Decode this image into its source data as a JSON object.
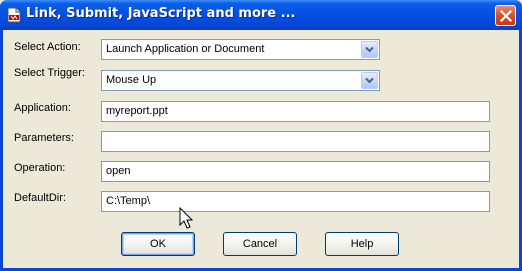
{
  "window": {
    "title": "Link, Submit, JavaScript and more ..."
  },
  "icons": {
    "title_icon": "pdf-document-icon",
    "close_icon": "close-x-icon",
    "dropdown_icon": "chevron-down-icon",
    "cursor_icon": "mouse-pointer-icon"
  },
  "form": {
    "select_action": {
      "label": "Select Action:",
      "value": "Launch Application or Document"
    },
    "select_trigger": {
      "label": "Select Trigger:",
      "value": "Mouse Up"
    },
    "application": {
      "label": "Application:",
      "value": "myreport.ppt"
    },
    "parameters": {
      "label": "Parameters:",
      "value": ""
    },
    "operation": {
      "label": "Operation:",
      "value": "open"
    },
    "default_dir": {
      "label": "DefaultDir:",
      "value": "C:\\Temp\\"
    }
  },
  "buttons": {
    "ok": "OK",
    "cancel": "Cancel",
    "help": "Help"
  },
  "colors": {
    "titlebar": "#0551e3",
    "dialog_bg": "#ece9d8",
    "field_border": "#7f9db9",
    "close_button": "#d8502a"
  }
}
